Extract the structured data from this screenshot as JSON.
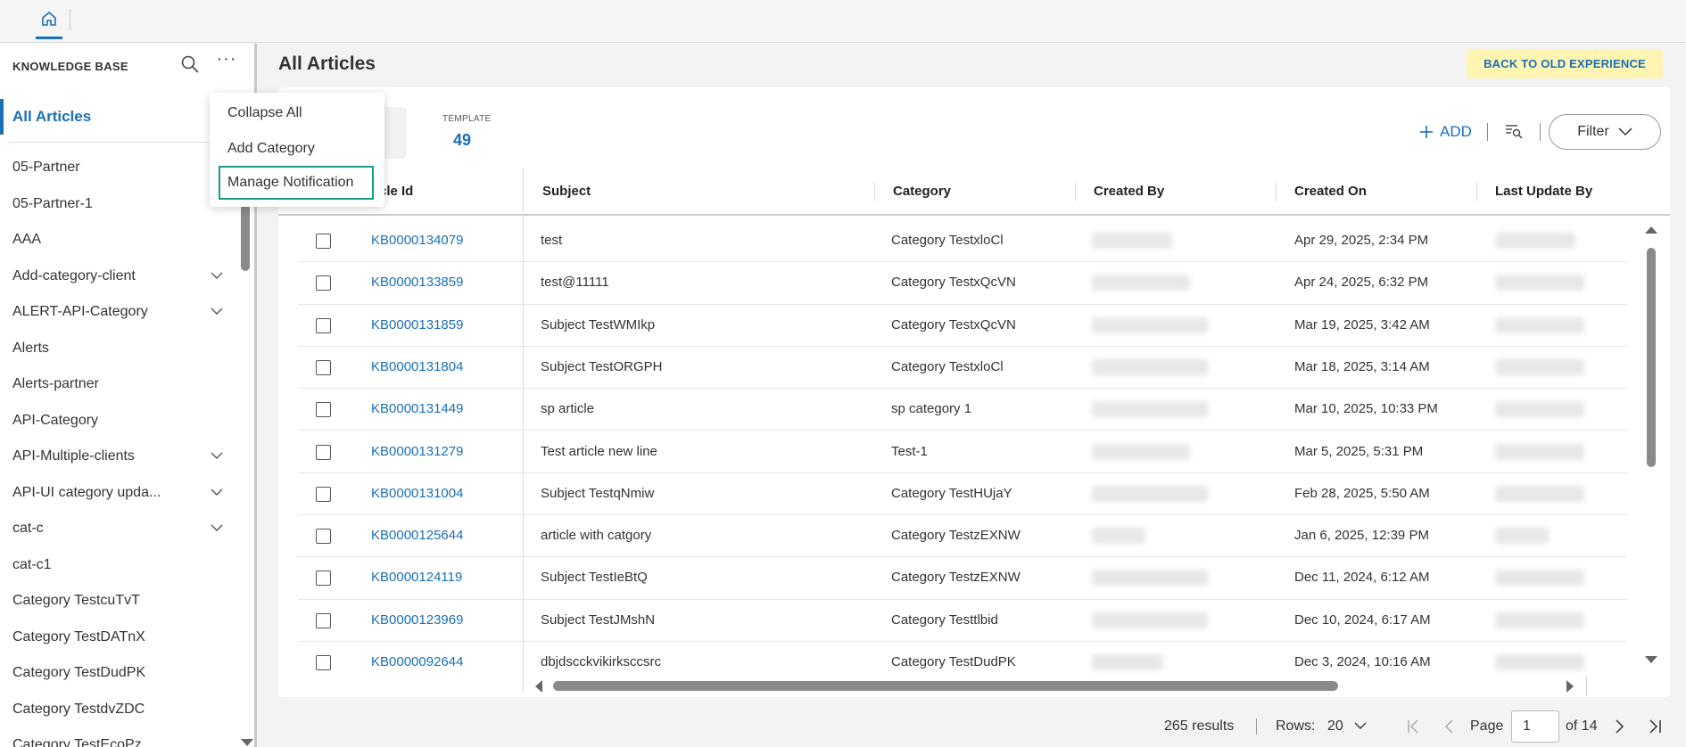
{
  "sidebar": {
    "header": "KNOWLEDGE BASE",
    "all_articles": "All Articles",
    "items": [
      {
        "label": "05-Partner",
        "expandable": false
      },
      {
        "label": "05-Partner-1",
        "expandable": false
      },
      {
        "label": "AAA",
        "expandable": false
      },
      {
        "label": "Add-category-client",
        "expandable": true
      },
      {
        "label": "ALERT-API-Category",
        "expandable": true
      },
      {
        "label": "Alerts",
        "expandable": false
      },
      {
        "label": "Alerts-partner",
        "expandable": false
      },
      {
        "label": "API-Category",
        "expandable": false
      },
      {
        "label": "API-Multiple-clients",
        "expandable": true
      },
      {
        "label": "API-UI category upda...",
        "expandable": true
      },
      {
        "label": "cat-c",
        "expandable": true
      },
      {
        "label": "cat-c1",
        "expandable": false
      },
      {
        "label": "Category TestcuTvT",
        "expandable": false
      },
      {
        "label": "Category TestDATnX",
        "expandable": false
      },
      {
        "label": "Category TestDudPK",
        "expandable": false
      },
      {
        "label": "Category TestdvZDC",
        "expandable": false
      },
      {
        "label": "Category TestEcoPz",
        "expandable": false
      }
    ]
  },
  "menu": {
    "items": [
      "Collapse All",
      "Add Category",
      "Manage Notification"
    ]
  },
  "main": {
    "title": "All Articles",
    "back_button": "BACK TO OLD EXPERIENCE",
    "template_label": "TEMPLATE",
    "template_count": "49",
    "add_label": "ADD",
    "filter_label": "Filter"
  },
  "table": {
    "headers": [
      "rticle Id",
      "Subject",
      "Category",
      "Created By",
      "Created On",
      "Last Update By"
    ],
    "rows": [
      {
        "id": "KB0000134079",
        "subject": "test",
        "category": "Category TestxloCl",
        "created_on": "Apr 29, 2025, 2:34 PM"
      },
      {
        "id": "KB0000133859",
        "subject": "test@11111",
        "category": "Category TestxQcVN",
        "created_on": "Apr 24, 2025, 6:32 PM"
      },
      {
        "id": "KB0000131859",
        "subject": "Subject TestWMIkp",
        "category": "Category TestxQcVN",
        "created_on": "Mar 19, 2025, 3:42 AM"
      },
      {
        "id": "KB0000131804",
        "subject": "Subject TestORGPH",
        "category": "Category TestxloCl",
        "created_on": "Mar 18, 2025, 3:14 AM"
      },
      {
        "id": "KB0000131449",
        "subject": "sp article",
        "category": "sp category 1",
        "created_on": "Mar 10, 2025, 10:33 PM"
      },
      {
        "id": "KB0000131279",
        "subject": "Test article new line",
        "category": "Test-1",
        "created_on": "Mar 5, 2025, 5:31 PM"
      },
      {
        "id": "KB0000131004",
        "subject": "Subject TestqNmiw",
        "category": "Category TestHUjaY",
        "created_on": "Feb 28, 2025, 5:50 AM"
      },
      {
        "id": "KB0000125644",
        "subject": "article with catgory",
        "category": "Category TestzEXNW",
        "created_on": "Jan 6, 2025, 12:39 PM"
      },
      {
        "id": "KB0000124119",
        "subject": "Subject TestIeBtQ",
        "category": "Category TestzEXNW",
        "created_on": "Dec 11, 2024, 6:12 AM"
      },
      {
        "id": "KB0000123969",
        "subject": "Subject TestJMshN",
        "category": "Category Testtlbid",
        "created_on": "Dec 10, 2024, 6:17 AM"
      },
      {
        "id": "KB0000092644",
        "subject": "dbjdscckvikirksccsrc",
        "category": "Category TestDudPK",
        "created_on": "Dec 3, 2024, 10:16 AM"
      }
    ]
  },
  "pagination": {
    "results": "265 results",
    "rows_label": "Rows:",
    "rows_value": "20",
    "page_label": "Page",
    "page_value": "1",
    "of_label": "of 14"
  },
  "colors": {
    "accent": "#1a6fb5",
    "menu_highlight": "#1a9a8a",
    "back_button_bg": "#fff5b3"
  }
}
